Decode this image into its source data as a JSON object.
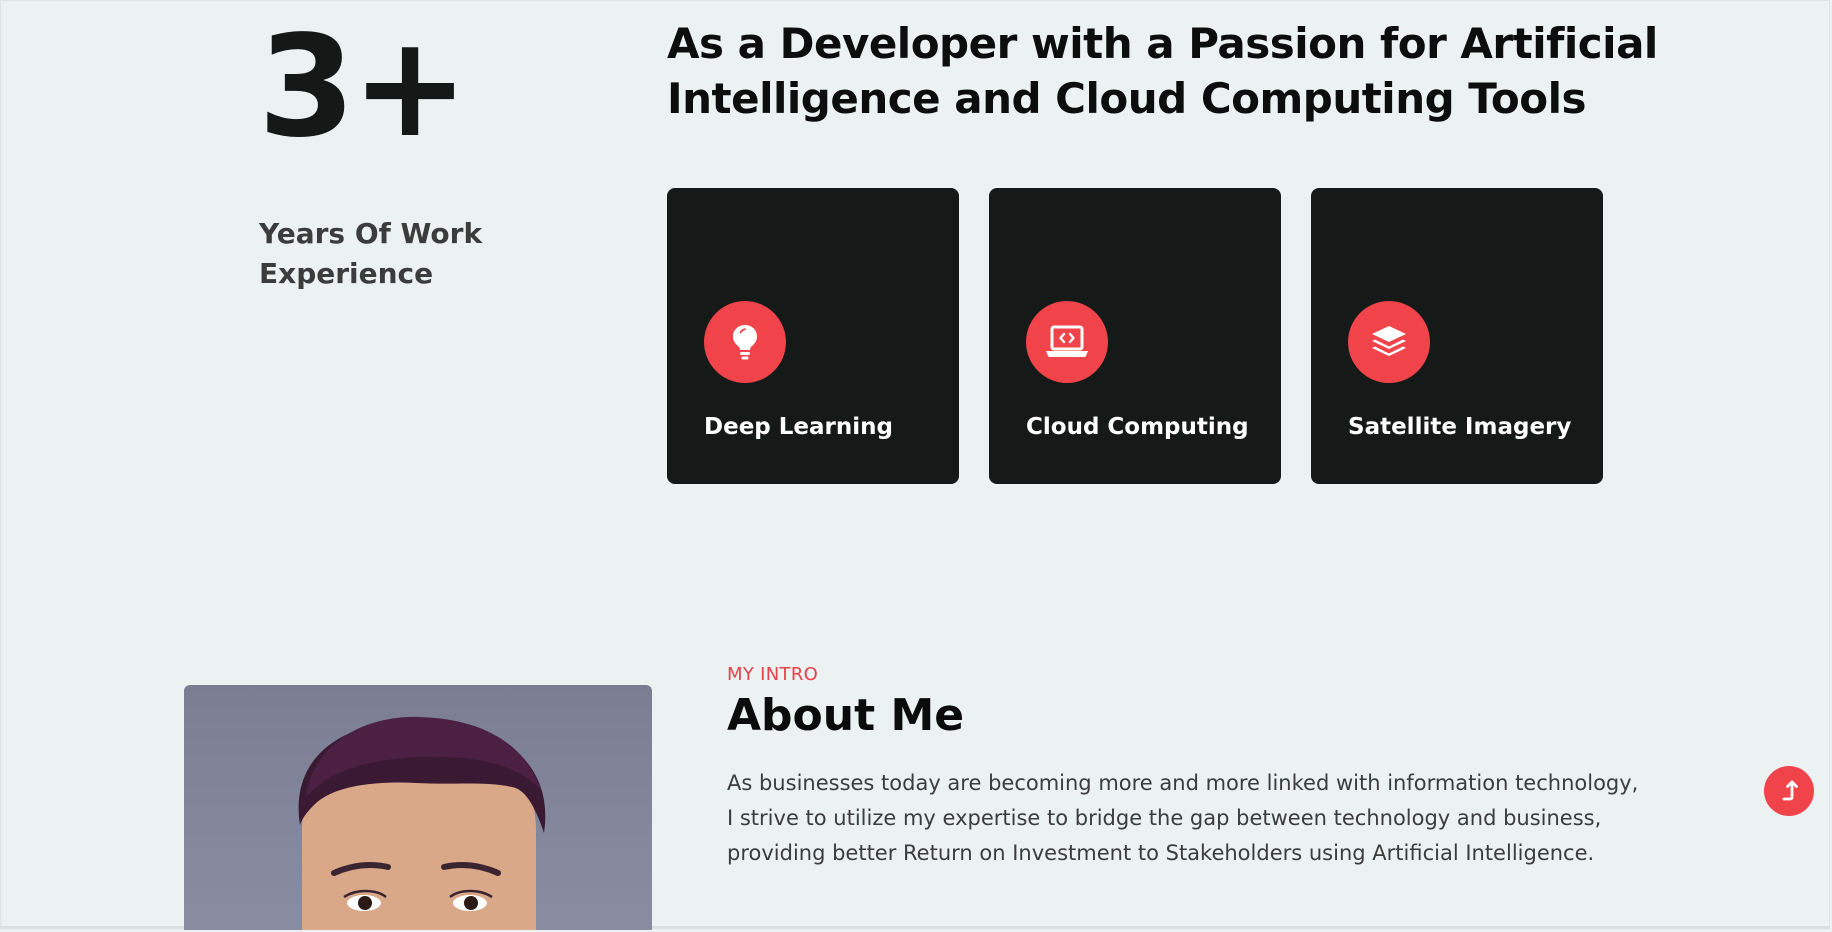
{
  "experience": {
    "number": "3+",
    "label": "Years Of Work Experience"
  },
  "headline": "As a Developer with a Passion for Artificial Intelligence and Cloud Computing Tools",
  "services": [
    {
      "title": "Deep Learning",
      "icon": "lightbulb-icon"
    },
    {
      "title": "Cloud Computing",
      "icon": "laptop-code-icon"
    },
    {
      "title": "Satellite Imagery",
      "icon": "layers-icon"
    }
  ],
  "about": {
    "eyebrow": "MY INTRO",
    "title": "About Me",
    "body": "As businesses today are becoming more and more linked with information technology, I strive to utilize my expertise to bridge the gap between technology and business, providing better Return on Investment to Stakeholders using Artificial Intelligence."
  },
  "colors": {
    "background": "#ecf1f1",
    "card": "#151918",
    "accent": "#f0434a"
  },
  "scroll_top": {
    "icon": "arrow-up-icon"
  }
}
